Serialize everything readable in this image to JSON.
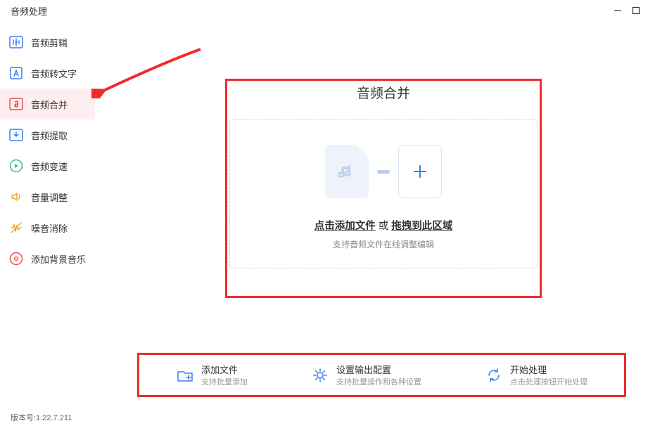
{
  "titlebar": {
    "title": "音频处理"
  },
  "sidebar": {
    "items": [
      {
        "label": "音频剪辑"
      },
      {
        "label": "音频转文字"
      },
      {
        "label": "音频合并"
      },
      {
        "label": "音频提取"
      },
      {
        "label": "音频变速"
      },
      {
        "label": "音量调整"
      },
      {
        "label": "噪音消除"
      },
      {
        "label": "添加背景音乐"
      }
    ]
  },
  "panel": {
    "title": "音频合并",
    "dropzone_click": "点击添加文件",
    "dropzone_or": "或",
    "dropzone_drag": "拖拽到此区域",
    "dropzone_hint": "支持音频文件在线调整编辑"
  },
  "bottombar": {
    "add": {
      "title": "添加文件",
      "sub": "支持批量添加"
    },
    "config": {
      "title": "设置输出配置",
      "sub": "支持批量操作和各种设置"
    },
    "start": {
      "title": "开始处理",
      "sub": "点击处理按钮开始处理"
    }
  },
  "version": "版本号:1.22.7.211"
}
